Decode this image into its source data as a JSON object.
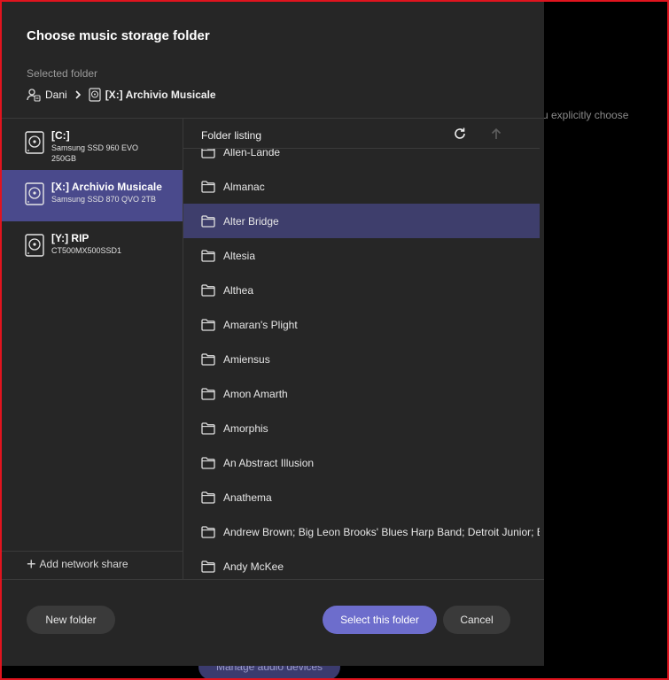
{
  "background": {
    "hint_text": "u explicitly choose",
    "bottom_button": "Manage audio devices"
  },
  "dialog": {
    "title": "Choose music storage folder",
    "selected_folder_label": "Selected folder",
    "breadcrumb": [
      {
        "label": "Dani",
        "icon": "user-icon"
      },
      {
        "label": "[X:] Archivio Musicale",
        "icon": "drive-icon"
      }
    ]
  },
  "drives": [
    {
      "name": "[C:]",
      "model": "Samsung SSD 960 EVO 250GB",
      "selected": false
    },
    {
      "name": "[X:] Archivio Musicale",
      "model": "Samsung SSD 870 QVO 2TB",
      "selected": true
    },
    {
      "name": "[Y:] RIP",
      "model": "CT500MX500SSD1",
      "selected": false
    }
  ],
  "add_network_share": "Add network share",
  "listing": {
    "header": "Folder listing",
    "folders": [
      "Allen-Lande",
      "Almanac",
      "Alter Bridge",
      "Altesia",
      "Althea",
      "Amaran's Plight",
      "Amiensus",
      "Amon Amarth",
      "Amorphis",
      "An Abstract Illusion",
      "Anathema",
      "Andrew Brown; Big Leon Brooks' Blues Harp Band; Detroit Junior; Eddie Taylor",
      "Andy McKee"
    ],
    "selected_folder": "Alter Bridge"
  },
  "buttons": {
    "new_folder": "New folder",
    "select_folder": "Select this folder",
    "cancel": "Cancel"
  },
  "colors": {
    "accent": "#6d6dcc",
    "selected_drive": "#4a4a8c",
    "selected_row": "#3e3e6c",
    "dialog_bg": "#262626"
  }
}
